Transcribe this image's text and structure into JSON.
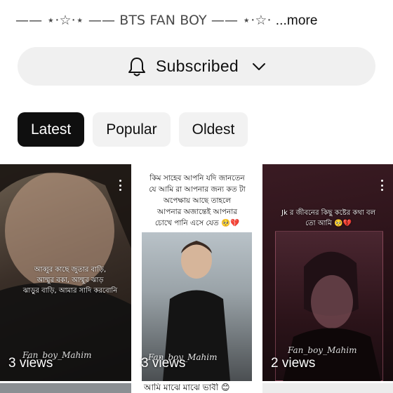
{
  "channel": {
    "description": "—— ⋆·☆·⋆ —— BTS FAN BOY —— ⋆·☆· ",
    "more_label": "...more"
  },
  "subscribe": {
    "label": "Subscribed",
    "icon": "bell-icon",
    "chevron": "chevron-down-icon"
  },
  "filters": {
    "chips": [
      {
        "label": "Latest",
        "selected": true
      },
      {
        "label": "Popular",
        "selected": false
      },
      {
        "label": "Oldest",
        "selected": false
      }
    ]
  },
  "videos": [
    {
      "views": "3 views",
      "overlay_text": "আব্বুর কাছে জুতার বাড়ি,\nআম্মুর বকা, আম্মুর ঝাড়\nঝাড়ুর বাড়ি, আমার সাদি করবোনি",
      "watermark": "Fan_boy_Mahim"
    },
    {
      "views": "3 views",
      "overlay_text": "কিম সাহেব আপনি যদি জানতেন\nযে আমি রা আপনার জন্য কত টা\nঅপেক্ষায় আছে তাহলে\nআপনার অজান্তেই আপনার\nচোখে পানি এসে যেত 🥺💔",
      "watermark": "Fan_boy_Mahim"
    },
    {
      "views": "2 views",
      "overlay_text": "Jk র জীবনের কিছু কষ্টের কথা বল\nতো আমি 🥺💔",
      "watermark": "Fan_boy_Mahim"
    }
  ],
  "next_row": {
    "caption": "আমি মাঝে মাঝে ভাবী 😊"
  },
  "colors": {
    "chip_active_bg": "#0f0f0f",
    "chip_bg": "#f2f2f2",
    "subscribe_bg": "#f0f0f0"
  }
}
